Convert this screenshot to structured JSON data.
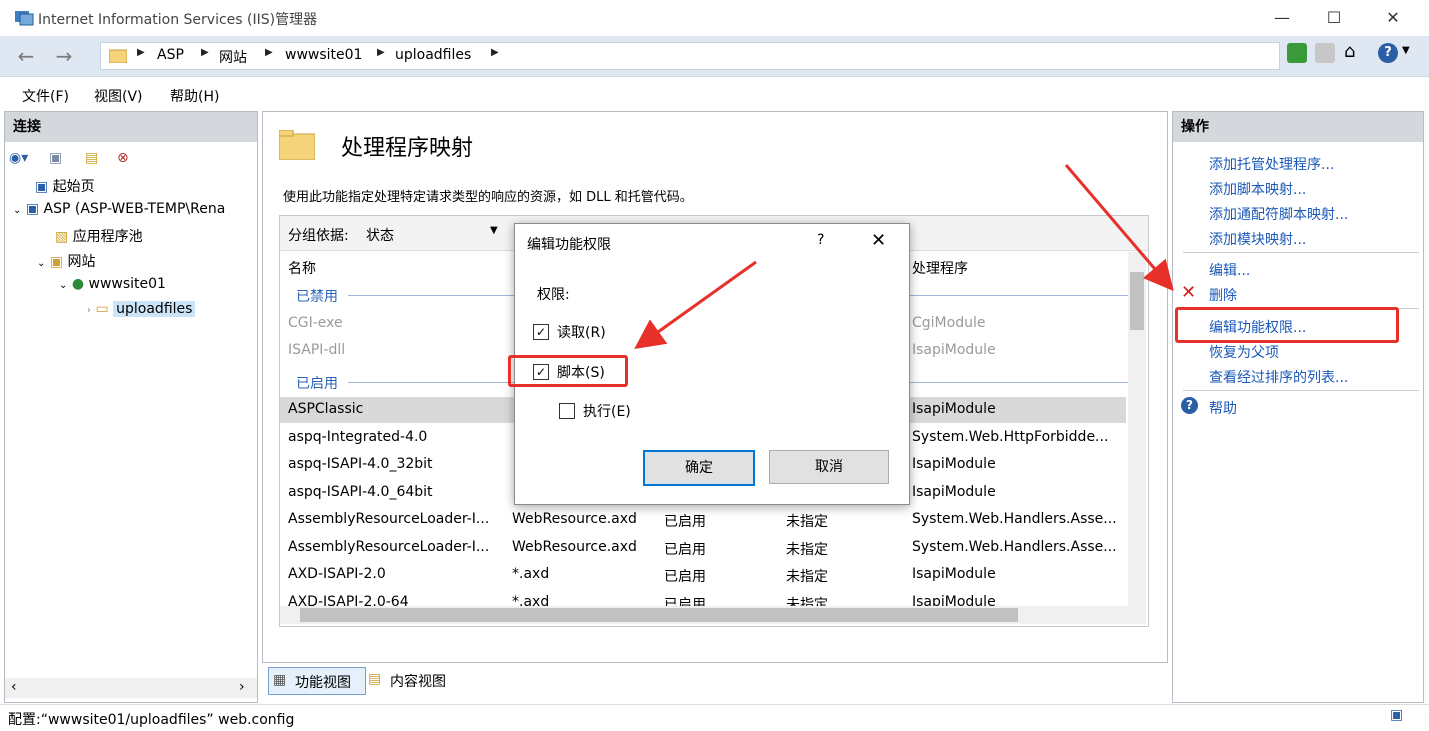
{
  "window": {
    "title": "Internet Information Services (IIS)管理器"
  },
  "address": {
    "crumbs": [
      "ASP",
      "网站",
      "wwwsite01",
      "uploadfiles"
    ]
  },
  "menu": {
    "file": "文件(F)",
    "view": "视图(V)",
    "help": "帮助(H)"
  },
  "connections": {
    "title": "连接",
    "tree": [
      "起始页",
      "ASP (ASP-WEB-TEMP\\Rena",
      "应用程序池",
      "网站",
      "wwwsite01",
      "uploadfiles"
    ]
  },
  "main": {
    "title": "处理程序映射",
    "description": "使用此功能指定处理特定请求类型的响应的资源，如 DLL 和托管代码。",
    "groupby_label": "分组依据:",
    "groupby_value": "状态",
    "columns": {
      "name": "名称",
      "handler": "处理程序"
    },
    "groups": {
      "disabled": "已禁用",
      "enabled": "已启用"
    },
    "disabled_rows": [
      {
        "name": "CGI-exe",
        "handler": "CgiModule"
      },
      {
        "name": "ISAPI-dll",
        "handler": "IsapiModule"
      }
    ],
    "enabled_rows": [
      {
        "name": "ASPClassic",
        "path": "",
        "state": "",
        "type": "",
        "handler": "IsapiModule"
      },
      {
        "name": "aspq-Integrated-4.0",
        "path": "",
        "state": "",
        "type": "",
        "handler": "System.Web.HttpForbidde..."
      },
      {
        "name": "aspq-ISAPI-4.0_32bit",
        "path": "",
        "state": "",
        "type": "",
        "handler": "IsapiModule"
      },
      {
        "name": "aspq-ISAPI-4.0_64bit",
        "path": "",
        "state": "",
        "type": "",
        "handler": "IsapiModule"
      },
      {
        "name": "AssemblyResourceLoader-I...",
        "path": "WebResource.axd",
        "state": "已启用",
        "type": "未指定",
        "handler": "System.Web.Handlers.Asse..."
      },
      {
        "name": "AssemblyResourceLoader-I...",
        "path": "WebResource.axd",
        "state": "已启用",
        "type": "未指定",
        "handler": "System.Web.Handlers.Asse..."
      },
      {
        "name": "AXD-ISAPI-2.0",
        "path": "*.axd",
        "state": "已启用",
        "type": "未指定",
        "handler": "IsapiModule"
      },
      {
        "name": "AXD-ISAPI-2.0-64",
        "path": "*.axd",
        "state": "已启用",
        "type": "未指定",
        "handler": "IsapiModule"
      }
    ],
    "tabs": {
      "feature_view": "功能视图",
      "content_view": "内容视图"
    }
  },
  "actions": {
    "title": "操作",
    "items": [
      "添加托管处理程序...",
      "添加脚本映射...",
      "添加通配符脚本映射...",
      "添加模块映射...",
      "编辑...",
      "删除",
      "编辑功能权限...",
      "恢复为父项",
      "查看经过排序的列表...",
      "帮助"
    ]
  },
  "dialog": {
    "title": "编辑功能权限",
    "help": "?",
    "permissions_label": "权限:",
    "read": "读取(R)",
    "script": "脚本(S)",
    "execute": "执行(E)",
    "ok": "确定",
    "cancel": "取消",
    "read_checked": true,
    "script_checked": true,
    "execute_checked": false
  },
  "status": {
    "text": "配置:“wwwsite01/uploadfiles” web.config"
  },
  "colors": {
    "annotation_red": "#e8302a",
    "link_blue": "#1a59b8",
    "header_grey": "#d4d7dc"
  }
}
